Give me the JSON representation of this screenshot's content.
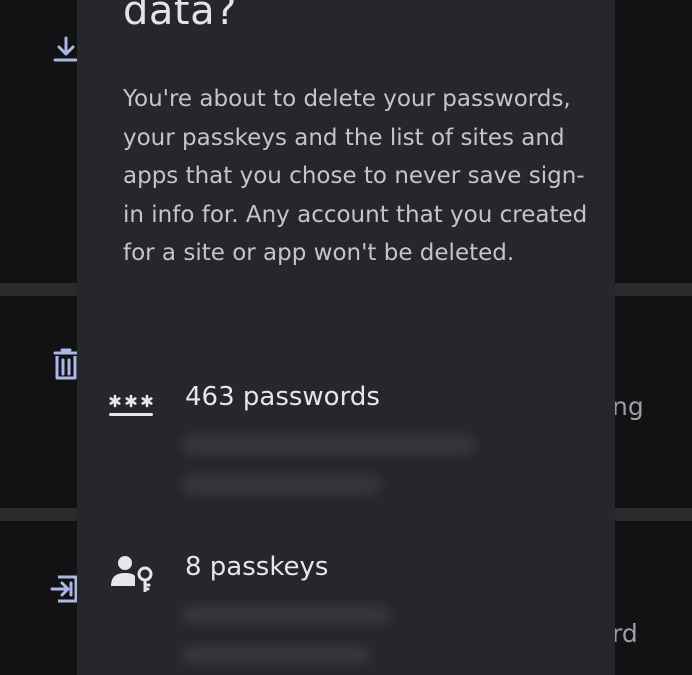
{
  "background": {
    "items": [
      {
        "icon": "download-icon",
        "label_fragment": ""
      },
      {
        "icon": "trash-icon",
        "label_fragment": "ng"
      },
      {
        "icon": "import-icon",
        "label_fragment": "rd"
      }
    ]
  },
  "dialog": {
    "title": "data?",
    "body": "You're about to delete your passwords, your passkeys and the list of sites and apps that you chose to never save sign-in info for. Any account that you created for a site or app won't be deleted.",
    "rows": [
      {
        "icon": "password-dots-icon",
        "label": "463 passwords"
      },
      {
        "icon": "passkey-person-icon",
        "label": "8 passkeys"
      }
    ]
  },
  "colors": {
    "dialog_background": "#26272a",
    "screen_background": "#121214",
    "icon_accent": "#a9b8e6",
    "text_primary": "#e6e6e9",
    "text_secondary": "#c4c5ca"
  }
}
